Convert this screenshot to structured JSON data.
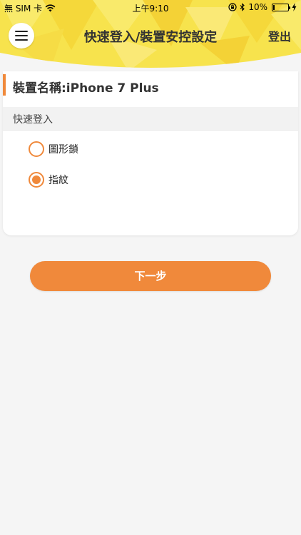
{
  "status_bar": {
    "carrier": "無 SIM 卡",
    "time": "上午9:10",
    "battery_percent": "10%",
    "battery_level": 0.1,
    "icons": [
      "wifi-icon",
      "rotation-lock-icon",
      "bluetooth-icon",
      "battery-icon",
      "charging-icon"
    ]
  },
  "header": {
    "title": "快速登入/裝置安控設定",
    "logout_label": "登出",
    "menu_icon": "hamburger-menu-icon",
    "colors": {
      "primary": "#f7e14a",
      "accent": "#f0893b"
    }
  },
  "device": {
    "name_label": "裝置名稱:iPhone 7 Plus"
  },
  "quick_login": {
    "section_label": "快速登入",
    "options": [
      {
        "label": "圖形鎖",
        "selected": false
      },
      {
        "label": "指紋",
        "selected": true
      }
    ]
  },
  "actions": {
    "next_label": "下一步"
  }
}
